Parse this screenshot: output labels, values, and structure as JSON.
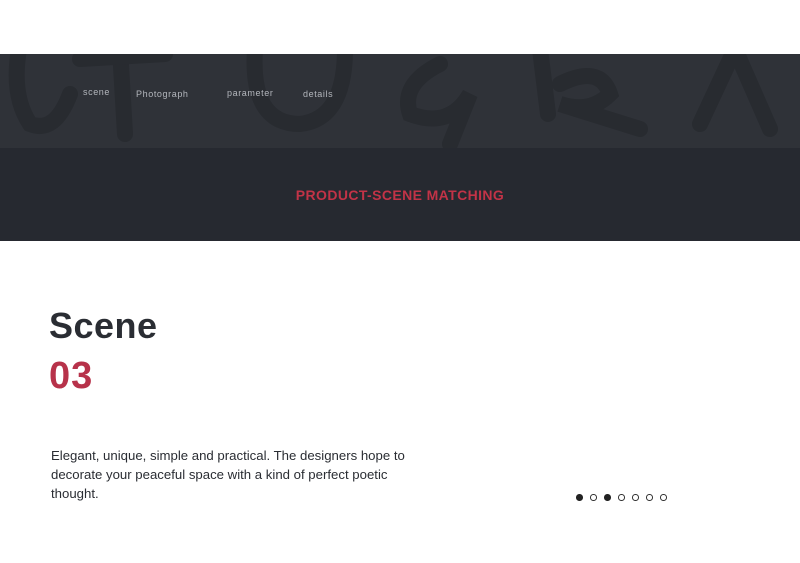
{
  "nav": {
    "items": [
      {
        "label": "scene"
      },
      {
        "label": "Photograph"
      },
      {
        "label": "parameter"
      },
      {
        "label": "details"
      }
    ],
    "background_color": "#2f3238"
  },
  "banner": {
    "title": "PRODUCT-SCENE MATCHING",
    "title_color": "#c23347",
    "background_color": "#262930"
  },
  "content": {
    "heading": "Scene",
    "number": "03",
    "number_color": "#b7324a",
    "description": "Elegant, unique, simple and practical. The designers hope to decorate your peaceful space with a kind of perfect poetic thought."
  },
  "carousel": {
    "total": 7,
    "filled_indices": [
      0,
      2
    ]
  }
}
